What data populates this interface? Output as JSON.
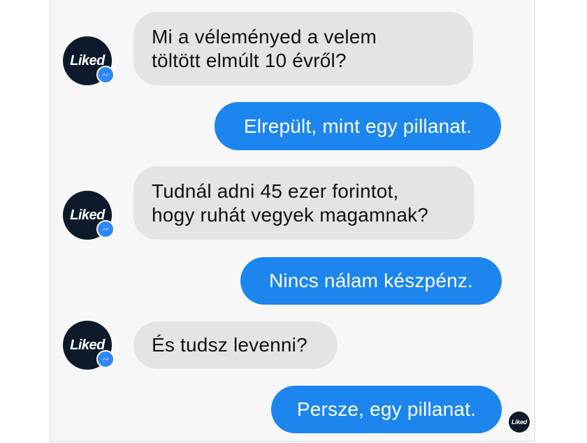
{
  "colors": {
    "incoming_bubble": "#e4e4e6",
    "outgoing_bubble": "#1c86ee",
    "avatar_bg": "#0c1a2b",
    "badge": "#2d88ff"
  },
  "contact": {
    "avatar_text": "Liked",
    "badge_icon": "messenger-icon"
  },
  "messages": [
    {
      "sender": "contact",
      "lines": [
        "Mi a véleményed a velem",
        "töltött elmúlt 10 évről?"
      ]
    },
    {
      "sender": "me",
      "lines": [
        "Elrepült, mint egy pillanat."
      ]
    },
    {
      "sender": "contact",
      "lines": [
        "Tudnál adni 45 ezer forintot,",
        "hogy ruhát vegyek magamnak?"
      ]
    },
    {
      "sender": "me",
      "lines": [
        "Nincs nálam készpénz."
      ]
    },
    {
      "sender": "contact",
      "lines": [
        "És tudsz levenni?"
      ]
    },
    {
      "sender": "me",
      "lines": [
        "Persze, egy pillanat."
      ]
    }
  ],
  "read_receipt": {
    "avatar_text": "Liked"
  }
}
